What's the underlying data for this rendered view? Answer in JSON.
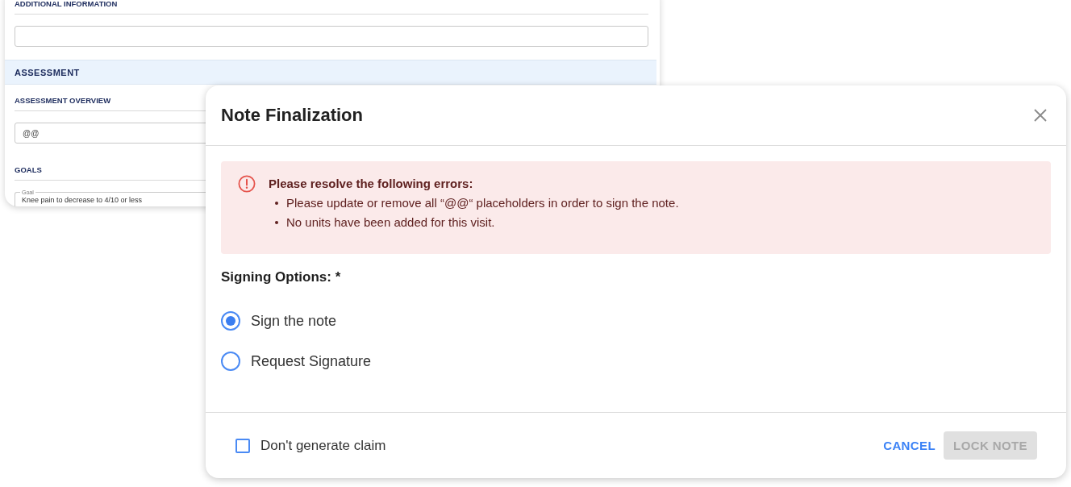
{
  "background_form": {
    "items": [
      {
        "kind": "subheading",
        "text": "ADDITIONAL INFORMATION"
      },
      {
        "kind": "field"
      },
      {
        "kind": "section",
        "text": "ASSESSMENT"
      },
      {
        "kind": "subheading",
        "text": "ASSESSMENT OVERVIEW"
      },
      {
        "kind": "field",
        "value": "@@"
      },
      {
        "kind": "subheading",
        "text": "GOALS"
      },
      {
        "kind": "outlined_field",
        "label": "Goal",
        "value": "Knee pain to decrease to 4/10 or less"
      }
    ]
  },
  "dialog": {
    "title": "Note Finalization",
    "alert": {
      "title": "Please resolve the following errors:",
      "items": [
        "Please update or remove all “@@“ placeholders in order to sign the note.",
        "No units have been added for this visit."
      ]
    },
    "signing_options": {
      "label": "Signing Options: *",
      "options": [
        {
          "label": "Sign the note",
          "selected": true
        },
        {
          "label": "Request Signature",
          "selected": false
        }
      ]
    },
    "footer": {
      "checkbox": {
        "label": "Don't generate claim",
        "checked": false
      },
      "buttons": [
        {
          "label": "CANCEL",
          "kind": "text",
          "disabled": false
        },
        {
          "label": "LOCK NOTE",
          "kind": "contained",
          "disabled": true
        }
      ]
    }
  }
}
